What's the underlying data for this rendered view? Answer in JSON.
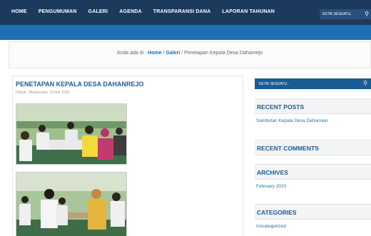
{
  "nav": {
    "items": [
      "HOME",
      "PENGUMUMAN",
      "GALERI",
      "AGENDA",
      "TRANSPARANSI DANA",
      "LAPORAN TAHUNAN"
    ],
    "search_placeholder": "KETIK SESUATU..",
    "search_icon": "search-icon"
  },
  "breadcrumb": {
    "prefix": "Anda ada di : ",
    "home": "Home",
    "sep": " / ",
    "section": "Galeri",
    "current": "Penetapan Kepala Desa Dahanrejo"
  },
  "post": {
    "title": "PENETAPAN KEPALA DESA DAHANREJO",
    "meta": "Dibuat : Wednesday, 18 Mar 2020"
  },
  "sidebar": {
    "search_placeholder": "KETIK SESUATU..",
    "widgets": [
      {
        "title": "RECENT POSTS",
        "items": [
          "Sambutan Kepala Desa Dahanrejo"
        ]
      },
      {
        "title": "RECENT COMMENTS",
        "items": []
      },
      {
        "title": "ARCHIVES",
        "items": [
          "February 2020"
        ]
      },
      {
        "title": "CATEGORIES",
        "items": [
          "Uncategorized"
        ]
      }
    ]
  },
  "colors": {
    "nav_bg": "#1b3a5e",
    "accent_blue": "#1d6fb4",
    "title_blue": "#1b5b94"
  }
}
